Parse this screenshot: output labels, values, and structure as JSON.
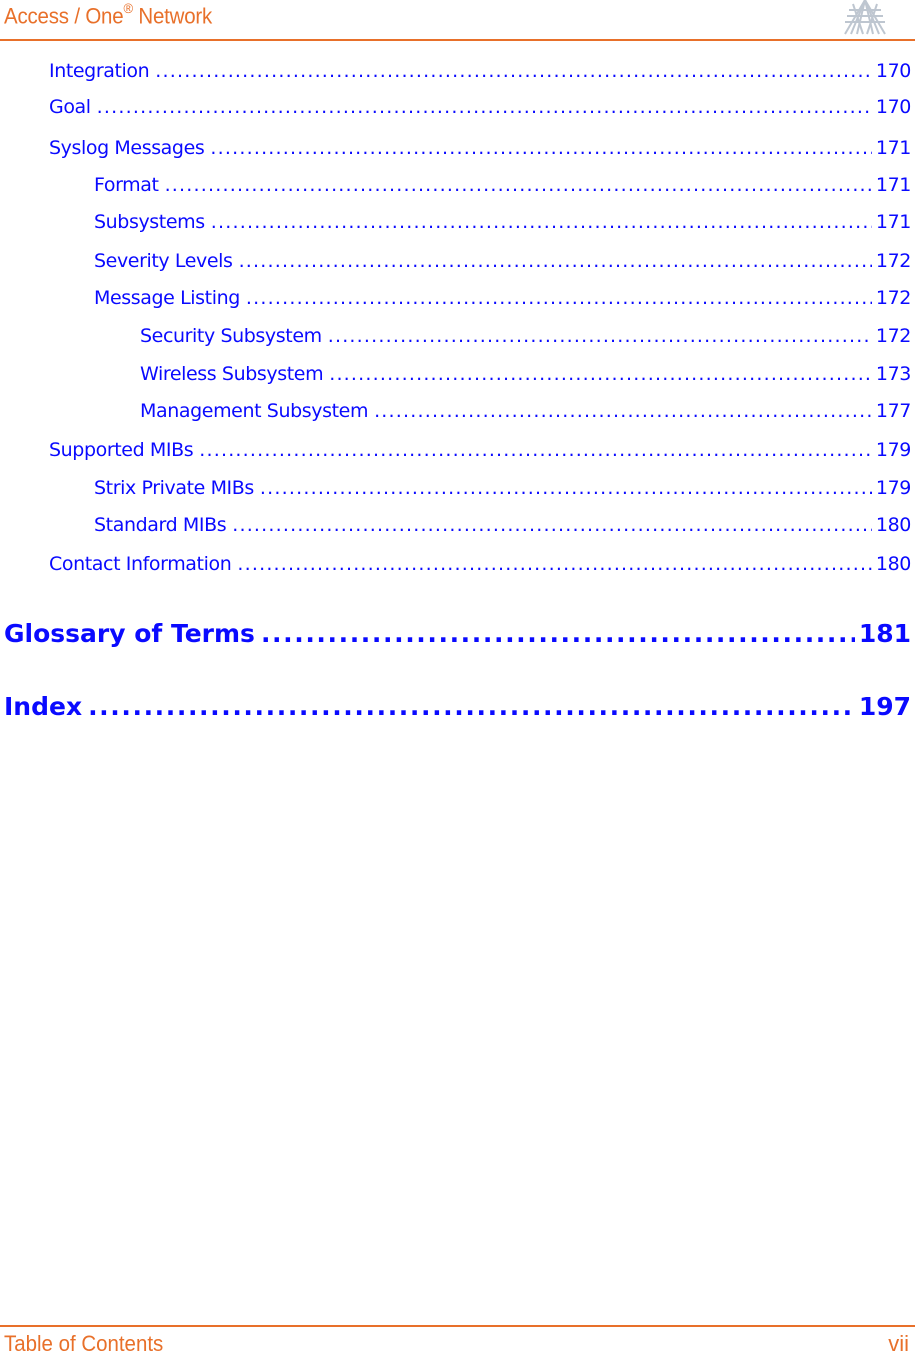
{
  "header": {
    "title_prefix": "Access / One",
    "title_sup": "®",
    "title_suffix": " Network",
    "logo_icon": "strix-logo-icon",
    "accent_color": "#e8702a"
  },
  "toc": {
    "link_color": "#0a0aff",
    "entries": [
      {
        "level": 1,
        "label": "Integration",
        "page": "170"
      },
      {
        "level": 1,
        "label": "Goal",
        "page": "170"
      },
      {
        "level": 1,
        "label": "Syslog Messages",
        "page": "171"
      },
      {
        "level": 2,
        "label": "Format",
        "page": "171"
      },
      {
        "level": 2,
        "label": "Subsystems",
        "page": "171"
      },
      {
        "level": 2,
        "label": "Severity Levels",
        "page": "172"
      },
      {
        "level": 2,
        "label": "Message Listing",
        "page": "172"
      },
      {
        "level": 3,
        "label": "Security Subsystem",
        "page": "172"
      },
      {
        "level": 3,
        "label": "Wireless Subsystem",
        "page": "173"
      },
      {
        "level": 3,
        "label": "Management Subsystem",
        "page": "177"
      },
      {
        "level": 1,
        "label": "Supported MIBs",
        "page": "179"
      },
      {
        "level": 2,
        "label": "Strix Private MIBs",
        "page": "179"
      },
      {
        "level": 2,
        "label": "Standard MIBs",
        "page": "180"
      },
      {
        "level": 1,
        "label": "Contact Information",
        "page": "180"
      },
      {
        "level": 0,
        "label": "Glossary of Terms",
        "page": "181"
      },
      {
        "level": 0,
        "label": "Index",
        "page": "197"
      }
    ]
  },
  "footer": {
    "section": "Table of Contents",
    "page_number": "vii"
  }
}
